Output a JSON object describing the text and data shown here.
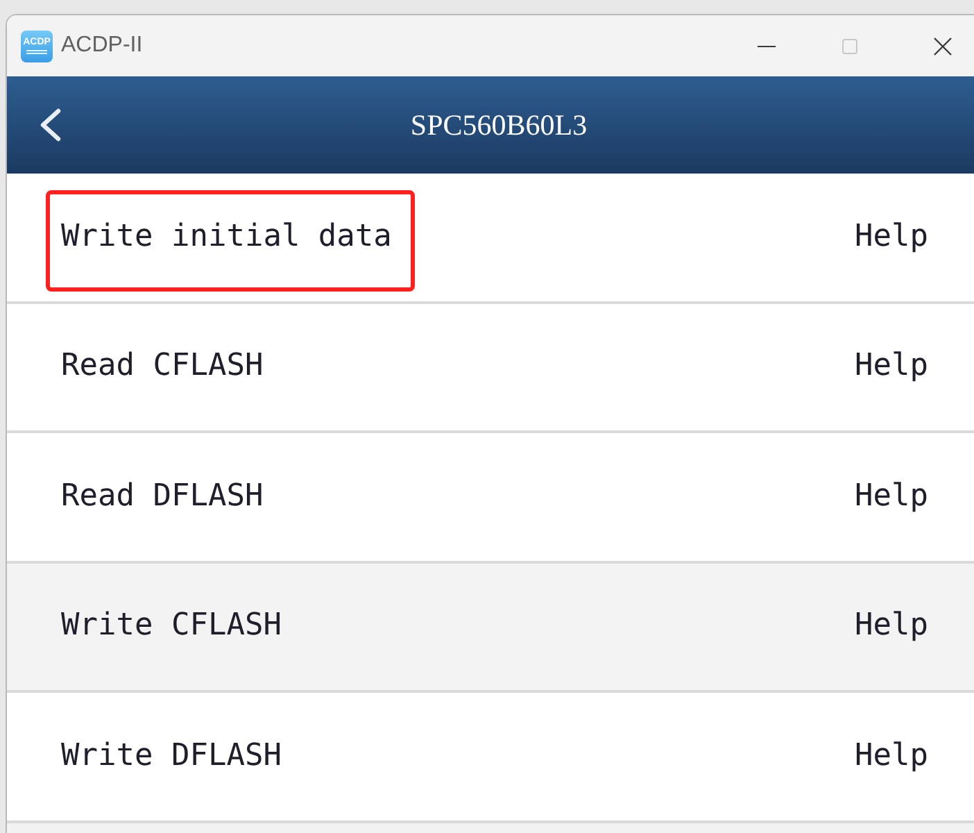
{
  "window": {
    "icon_label": "ACDP",
    "title": "ACDP-II",
    "controls": [
      {
        "kind": "minimize",
        "disabled": false
      },
      {
        "kind": "maximize",
        "disabled": true
      },
      {
        "kind": "close",
        "disabled": false
      }
    ]
  },
  "header": {
    "title": "SPC560B60L3"
  },
  "items": [
    {
      "label": "Write initial data",
      "help": "Help",
      "hovered": false,
      "marked": true
    },
    {
      "label": "Read CFLASH",
      "help": "Help",
      "hovered": false,
      "marked": false
    },
    {
      "label": "Read DFLASH",
      "help": "Help",
      "hovered": false,
      "marked": false
    },
    {
      "label": "Write CFLASH",
      "help": "Help",
      "hovered": true,
      "marked": false
    },
    {
      "label": "Write DFLASH",
      "help": "Help",
      "hovered": false,
      "marked": false
    }
  ]
}
